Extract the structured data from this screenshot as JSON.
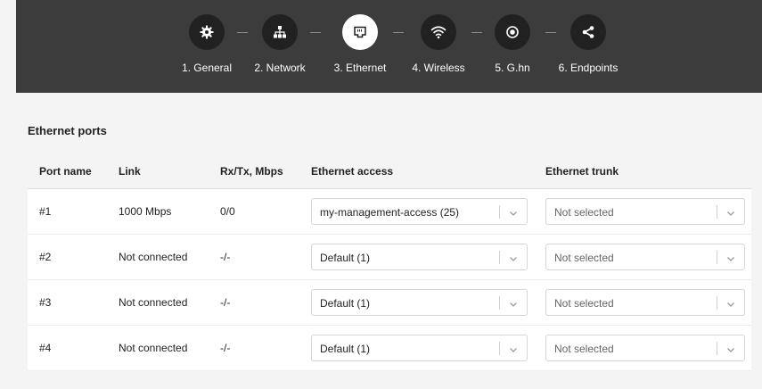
{
  "wizard": {
    "steps": [
      {
        "label": "1. General",
        "icon": "gear-icon",
        "active": false
      },
      {
        "label": "2. Network",
        "icon": "network-icon",
        "active": false
      },
      {
        "label": "3. Ethernet",
        "icon": "ethernet-port-icon",
        "active": true
      },
      {
        "label": "4. Wireless",
        "icon": "wifi-icon",
        "active": false
      },
      {
        "label": "5. G.hn",
        "icon": "target-icon",
        "active": false
      },
      {
        "label": "6. Endpoints",
        "icon": "share-icon",
        "active": false
      }
    ],
    "colors": {
      "bar": "#3c3c3c",
      "circle": "#212121",
      "active_circle": "#ffffff"
    }
  },
  "section": {
    "title": "Ethernet ports"
  },
  "table": {
    "headers": [
      "Port name",
      "Link",
      "Rx/Tx, Mbps",
      "Ethernet access",
      "Ethernet trunk"
    ],
    "rows": [
      {
        "port": "#1",
        "link": "1000 Mbps",
        "rxtx": "0/0",
        "access": "my-management-access (25)",
        "trunk": "Not selected"
      },
      {
        "port": "#2",
        "link": "Not connected",
        "rxtx": "-/-",
        "access": "Default (1)",
        "trunk": "Not selected"
      },
      {
        "port": "#3",
        "link": "Not connected",
        "rxtx": "-/-",
        "access": "Default (1)",
        "trunk": "Not selected"
      },
      {
        "port": "#4",
        "link": "Not connected",
        "rxtx": "-/-",
        "access": "Default (1)",
        "trunk": "Not selected"
      }
    ]
  }
}
